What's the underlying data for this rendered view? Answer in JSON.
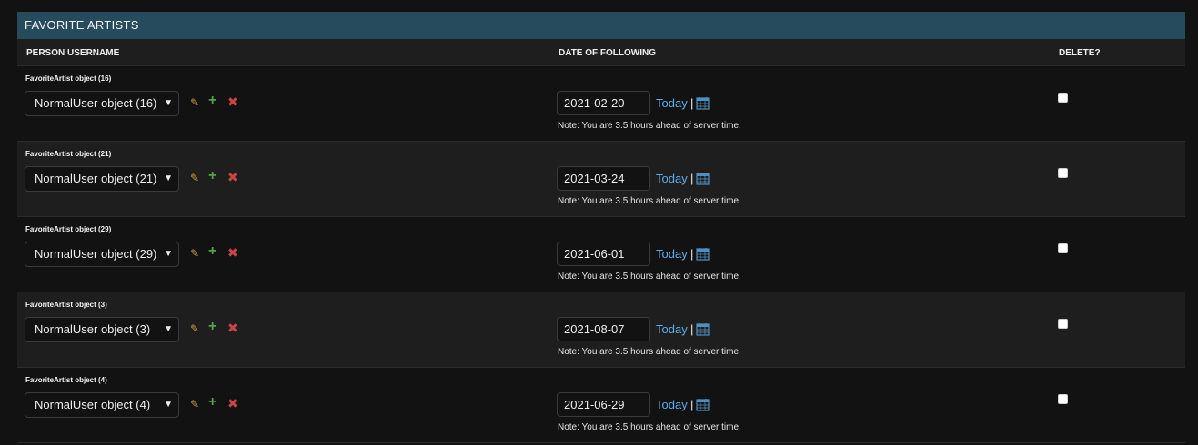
{
  "module": {
    "caption": "FAVORITE ARTISTS",
    "headers": {
      "person": "PERSON USERNAME",
      "date": "DATE OF FOLLOWING",
      "delete": "DELETE?"
    }
  },
  "rows": [
    {
      "object_label": "FavoriteArtist object (16)",
      "select_value": "NormalUser object (16)",
      "date": "2021-02-20",
      "today": "Today",
      "sep": "|",
      "note": "Note: You are 3.5 hours ahead of server time."
    },
    {
      "object_label": "FavoriteArtist object (21)",
      "select_value": "NormalUser object (21)",
      "date": "2021-03-24",
      "today": "Today",
      "sep": "|",
      "note": "Note: You are 3.5 hours ahead of server time."
    },
    {
      "object_label": "FavoriteArtist object (29)",
      "select_value": "NormalUser object (29)",
      "date": "2021-06-01",
      "today": "Today",
      "sep": "|",
      "note": "Note: You are 3.5 hours ahead of server time."
    },
    {
      "object_label": "FavoriteArtist object (3)",
      "select_value": "NormalUser object (3)",
      "date": "2021-08-07",
      "today": "Today",
      "sep": "|",
      "note": "Note: You are 3.5 hours ahead of server time."
    },
    {
      "object_label": "FavoriteArtist object (4)",
      "select_value": "NormalUser object (4)",
      "date": "2021-06-29",
      "today": "Today",
      "sep": "|",
      "note": "Note: You are 3.5 hours ahead of server time."
    }
  ],
  "icons": {
    "edit": "pencil-icon",
    "add": "plus-icon",
    "remove": "cross-icon",
    "calendar": "calendar-icon",
    "dropdown": "chevron-down-icon"
  },
  "colors": {
    "caption_bg": "#264b5d",
    "link": "#5eaeec",
    "edit": "#c9a13a",
    "add": "#53a14a",
    "remove": "#c94545"
  }
}
